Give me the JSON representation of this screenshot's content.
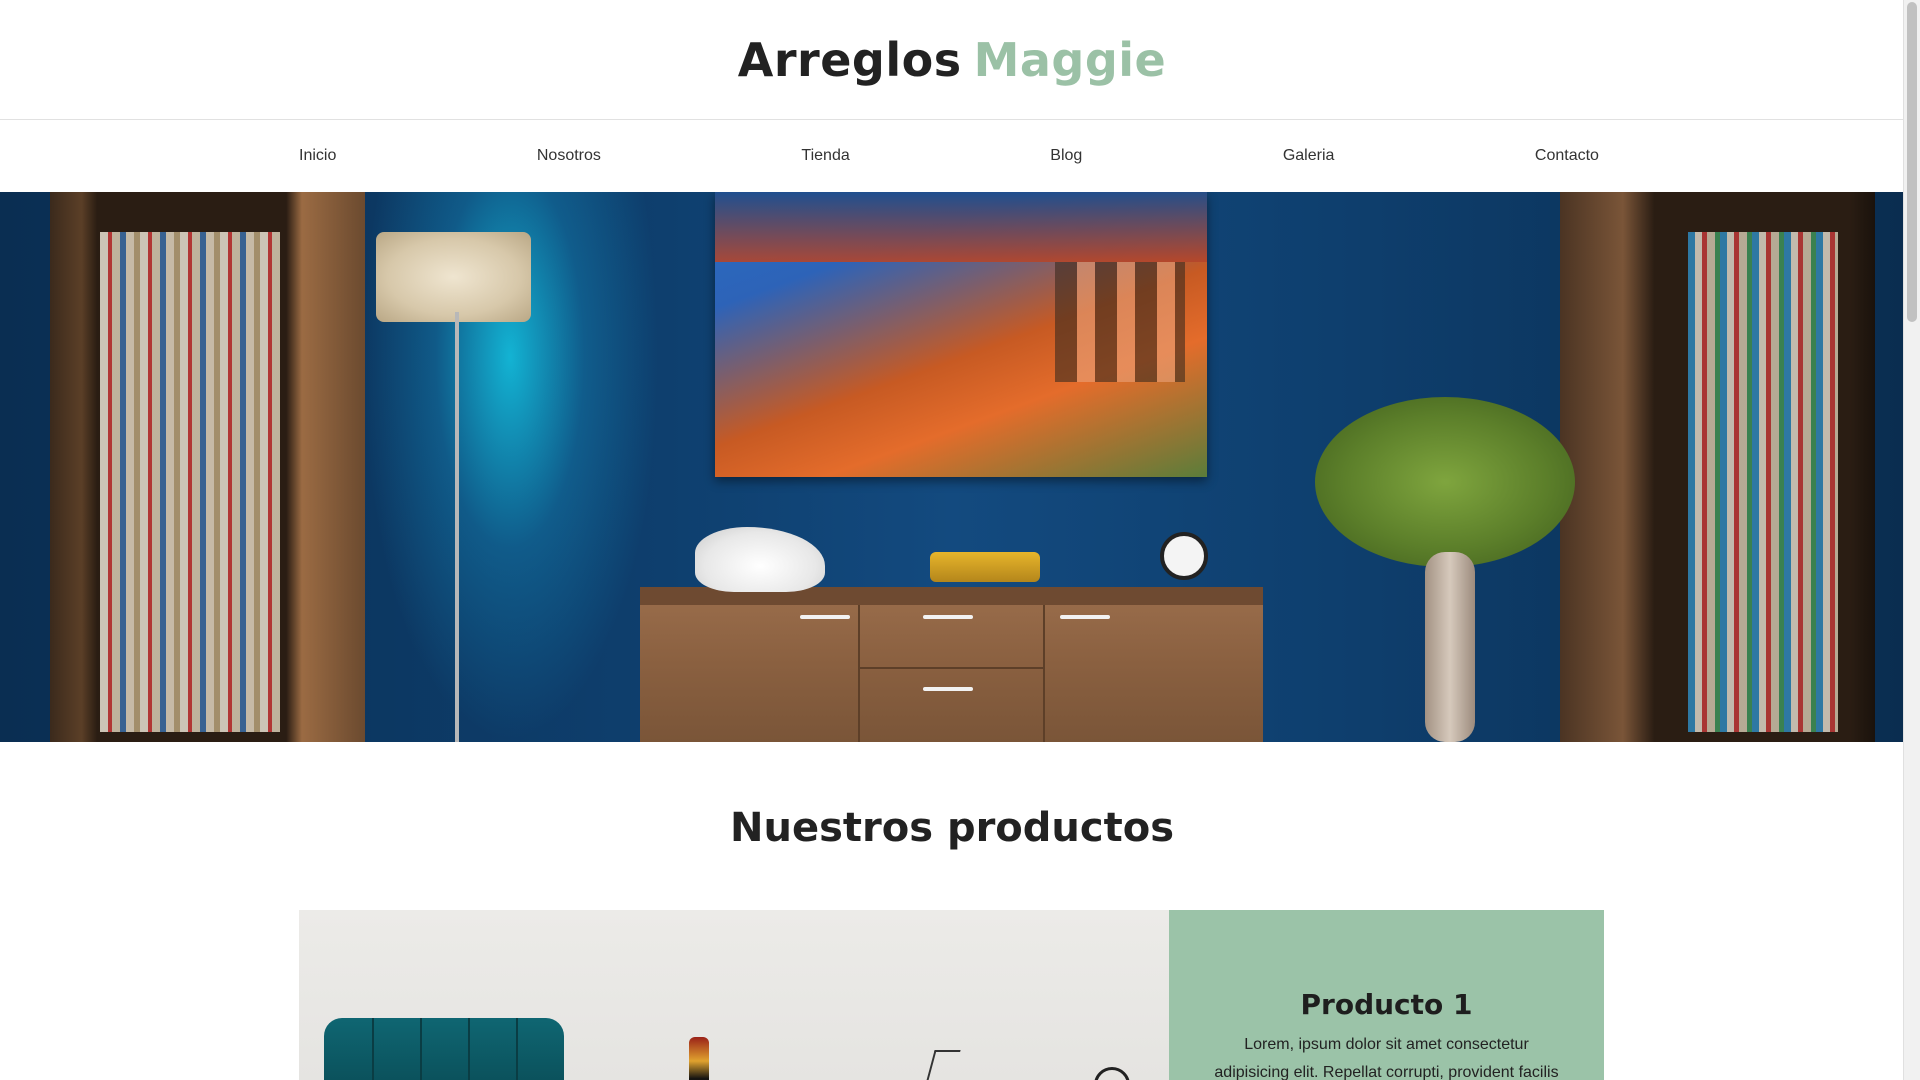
{
  "brand": {
    "part1": "Arreglos",
    "part2": "Maggie",
    "accent": "#9bc1a6"
  },
  "nav": [
    "Inicio",
    "Nosotros",
    "Tienda",
    "Blog",
    "Galeria",
    "Contacto"
  ],
  "products": {
    "title": "Nuestros productos",
    "items": [
      {
        "name": "Producto 1",
        "description": "Lorem, ipsum dolor sit amet consectetur adipisicing elit. Repellat corrupti, provident facilis"
      }
    ]
  },
  "colors": {
    "product_panel": "#9bc3a8",
    "text": "#1a1a1a"
  }
}
